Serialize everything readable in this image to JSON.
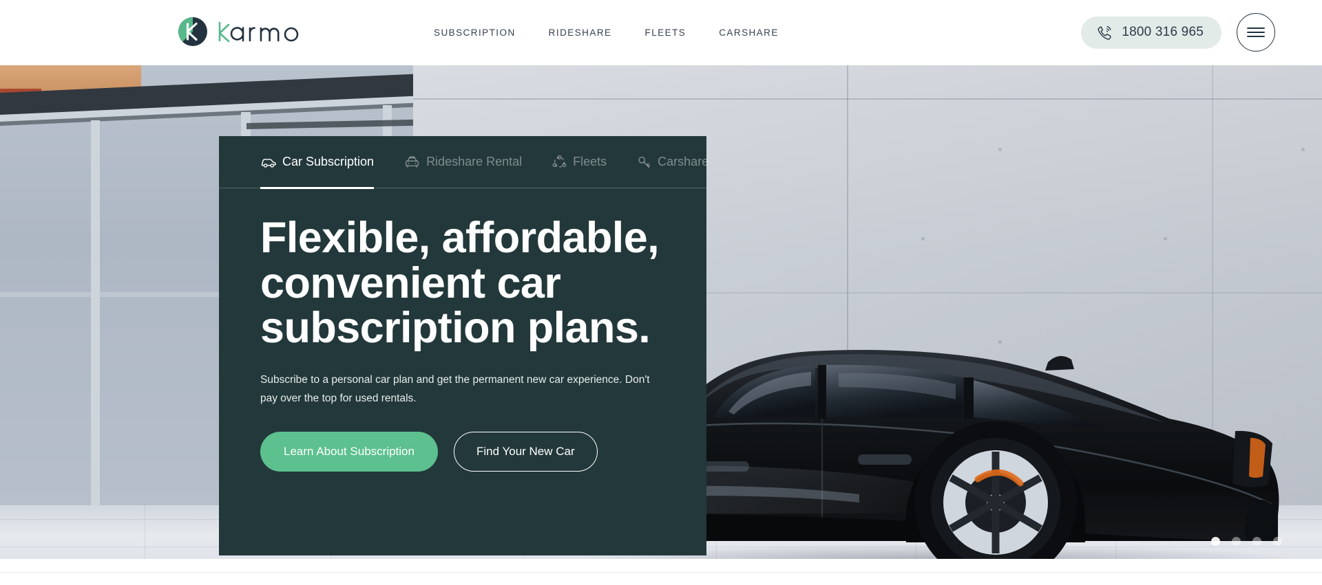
{
  "header": {
    "logo_text": "karmo",
    "logo_icon": "karmo-circle-k-logo",
    "nav": [
      {
        "label": "SUBSCRIPTION"
      },
      {
        "label": "RIDESHARE"
      },
      {
        "label": "FLEETS"
      },
      {
        "label": "CARSHARE"
      }
    ],
    "phone": {
      "icon": "phone-ringing-icon",
      "number": "1800 316 965"
    },
    "menu_icon": "hamburger-menu-icon"
  },
  "hero": {
    "tabs": [
      {
        "label": "Car Subscription",
        "icon": "car-icon",
        "active": true
      },
      {
        "label": "Rideshare Rental",
        "icon": "taxi-icon",
        "active": false
      },
      {
        "label": "Fleets",
        "icon": "fleet-network-icon",
        "active": false
      },
      {
        "label": "Carshare",
        "icon": "key-icon",
        "active": false
      }
    ],
    "headline": "Flexible, affordable, convenient car subscription plans.",
    "subcopy": "Subscribe to a personal car plan and get the permanent new car experience. Don't pay over the top for used rentals.",
    "primary_cta": "Learn About Subscription",
    "secondary_cta": "Find Your New Car",
    "carousel": {
      "total": 4,
      "active_index": 0
    },
    "background_alt": "black electric sedan parked in front of a concrete wall"
  },
  "colors": {
    "panel_bg": "#23383a",
    "accent_green": "#5cc08f",
    "logo_green": "#55b98a",
    "nav_text": "#35404e",
    "phone_pill_bg": "#e3ebe8",
    "page_bg": "#ffffff"
  }
}
